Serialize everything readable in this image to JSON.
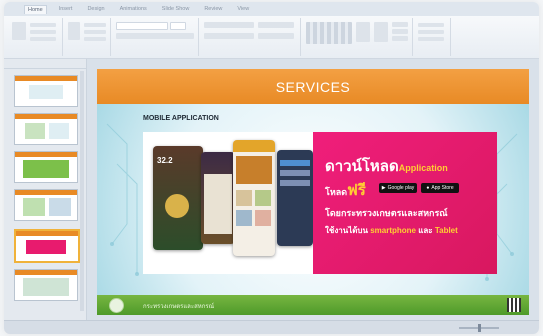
{
  "ribbon": {
    "tabs": [
      "Home",
      "Insert",
      "Design",
      "Animations",
      "Slide Show",
      "Review",
      "View"
    ],
    "active_tab": 0
  },
  "slide": {
    "title": "SERVICES",
    "subtitle": "MOBILE APPLICATION",
    "promo": {
      "line1_main": "ดาวน์โหลด",
      "line1_accent": "Application",
      "line2_main": "โหลด",
      "line2_accent": "ฟรี",
      "line3": "โดยกระทรวงเกษตรและสหกรณ์",
      "line4_main": "ใช้งานได้บน",
      "line4_accent1": "smartphone",
      "line4_mid": "และ",
      "line4_accent2": "Tablet",
      "store1": "Google play",
      "store2": "App Store",
      "phone_temp": "32.2"
    },
    "footer_text": "กระทรวงเกษตรและสหกรณ์"
  },
  "colors": {
    "header": "#e88a25",
    "banner_pink": "#e81b6e",
    "footer_green": "#5ea632",
    "accent_orange": "#f7a21b"
  },
  "icons": {
    "google_play": "play-triangle-icon",
    "app_store": "apple-icon"
  }
}
